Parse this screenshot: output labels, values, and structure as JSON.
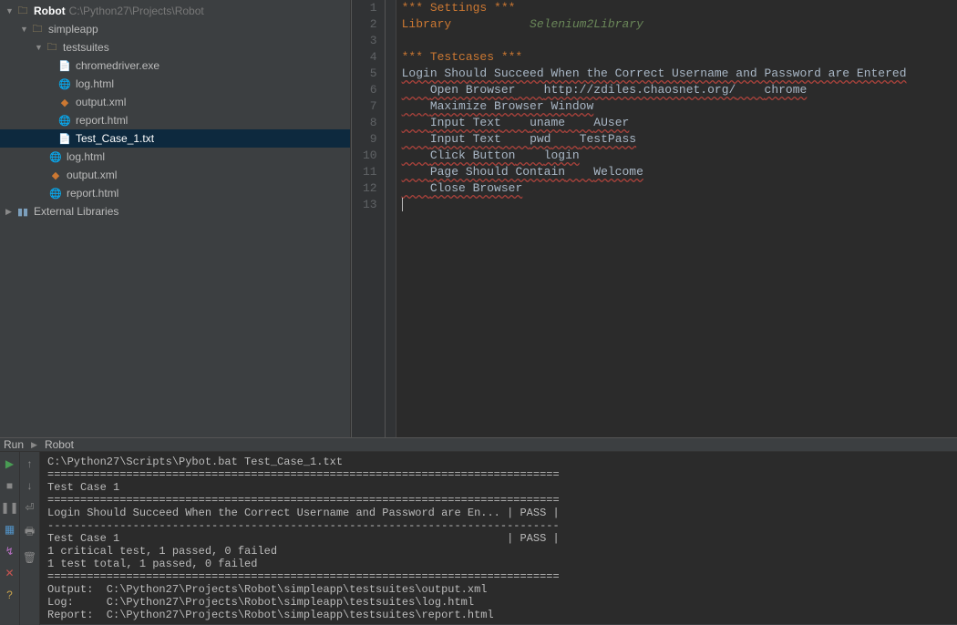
{
  "project": {
    "root_name": "Robot",
    "root_path": "C:\\Python27\\Projects\\Robot"
  },
  "tree": {
    "simpleapp": "simpleapp",
    "testsuites": "testsuites",
    "chromedriver": "chromedriver.exe",
    "loghtml": "log.html",
    "outputxml": "output.xml",
    "reporthtml": "report.html",
    "testcase1": "Test_Case_1.txt",
    "loghtml2": "log.html",
    "outputxml2": "output.xml",
    "reporthtml2": "report.html",
    "extlibs": "External Libraries"
  },
  "editor": {
    "line1": "*** Settings ***",
    "line2a": "Library",
    "line2b": "Selenium2Library",
    "line4": "*** Testcases ***",
    "line5": "Login Should Succeed When the Correct Username and Password are Entered",
    "line6a": "Open Browser",
    "line6b": "http://zdiles.chaosnet.org/",
    "line6c": "chrome",
    "line7": "Maximize Browser Window",
    "line8a": "Input Text",
    "line8b": "uname",
    "line8c": "AUser",
    "line9a": "Input Text",
    "line9b": "pwd",
    "line9c": "TestPass",
    "line10a": "Click Button",
    "line10b": "login",
    "line11a": "Page Should Contain",
    "line11b": "Welcome",
    "line12": "Close Browser"
  },
  "linenums": [
    "1",
    "2",
    "3",
    "4",
    "5",
    "6",
    "7",
    "8",
    "9",
    "10",
    "11",
    "12",
    "13"
  ],
  "runbar": {
    "runlabel": "Run",
    "confname": "Robot"
  },
  "console": {
    "l1": "C:\\Python27\\Scripts\\Pybot.bat Test_Case_1.txt",
    "sep": "==============================================================================",
    "l2": "Test Case 1",
    "l3": "Login Should Succeed When the Correct Username and Password are En... | PASS |",
    "dash": "------------------------------------------------------------------------------",
    "l4": "Test Case 1                                                           | PASS |",
    "l5": "1 critical test, 1 passed, 0 failed",
    "l6": "1 test total, 1 passed, 0 failed",
    "l7": "Output:  C:\\Python27\\Projects\\Robot\\simpleapp\\testsuites\\output.xml",
    "l8": "Log:     C:\\Python27\\Projects\\Robot\\simpleapp\\testsuites\\log.html",
    "l9": "Report:  C:\\Python27\\Projects\\Robot\\simpleapp\\testsuites\\report.html"
  }
}
